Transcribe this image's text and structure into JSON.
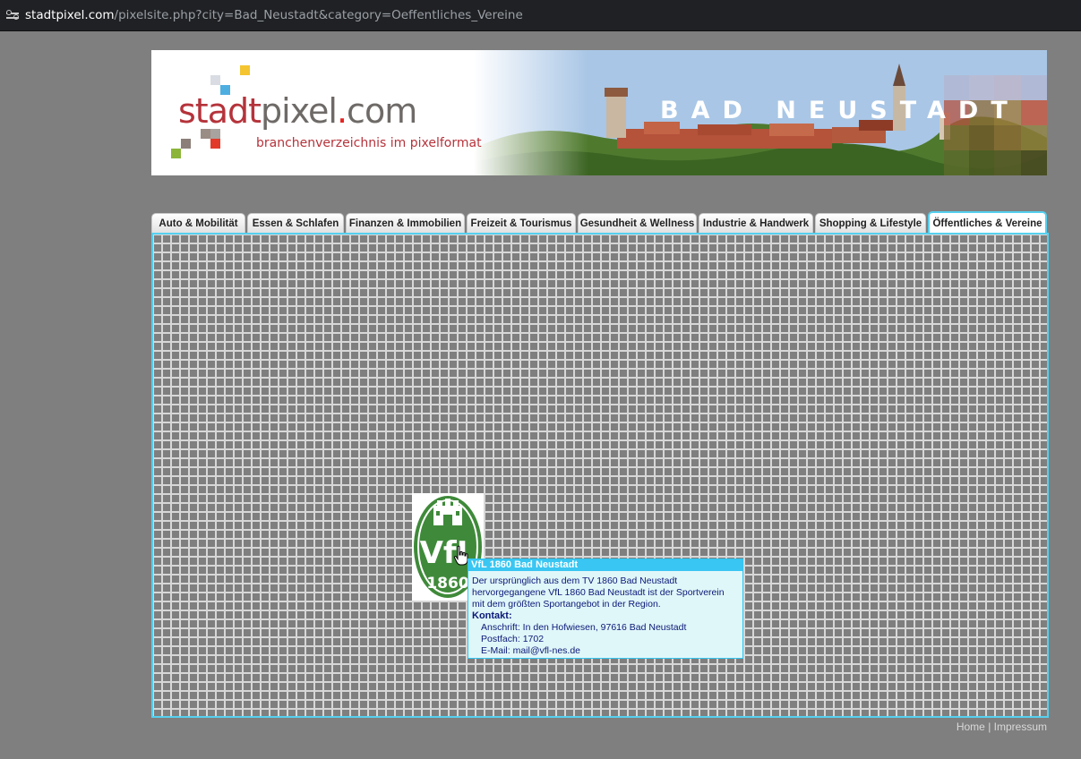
{
  "browser": {
    "url_domain": "stadtpixel.com",
    "url_path": "/pixelsite.php?city=Bad_Neustadt&category=Oeffentliches_Vereine",
    "site_info_icon": "tune-icon"
  },
  "header": {
    "logo_part1": "stadt",
    "logo_part2": "pixel",
    "logo_dot": ".",
    "logo_part3": "com",
    "logo_subtitle": "branchenverzeichnis im pixelformat",
    "city_name": "BAD NEUSTADT"
  },
  "tabs": [
    {
      "label": "Auto & Mobilität",
      "active": false
    },
    {
      "label": "Essen & Schlafen",
      "active": false
    },
    {
      "label": "Finanzen & Immobilien",
      "active": false
    },
    {
      "label": "Freizeit & Tourismus",
      "active": false
    },
    {
      "label": "Gesundheit & Wellness",
      "active": false
    },
    {
      "label": "Industrie & Handwerk",
      "active": false
    },
    {
      "label": "Shopping & Lifestyle",
      "active": false
    },
    {
      "label": "Öffentliches & Vereine",
      "active": true
    }
  ],
  "pixel_entry": {
    "logo_text": "VfL",
    "logo_year": "1860",
    "tooltip": {
      "title": "VfL 1860 Bad Neustadt",
      "description_line1": "Der ursprünglich aus dem TV 1860 Bad Neustadt",
      "description_line2": "hervorgegangene VfL 1860 Bad Neustadt ist der Sportverein",
      "description_line3": "mit dem größten Sportangebot in der Region.",
      "contact_label": "Kontakt:",
      "address": "Anschrift: In den Hofwiesen, 97616 Bad Neustadt",
      "postbox": "Postfach: 1702",
      "email": "E-Mail: mail@vfl-nes.de"
    }
  },
  "footer": {
    "home": "Home",
    "separator": "|",
    "impressum": "Impressum"
  },
  "colors": {
    "page_bg": "#7f7f7f",
    "accent_cyan": "#55d0ef",
    "logo_red": "#b5333b",
    "logo_gray": "#6e6a67",
    "vfl_green": "#3f8a3a"
  }
}
